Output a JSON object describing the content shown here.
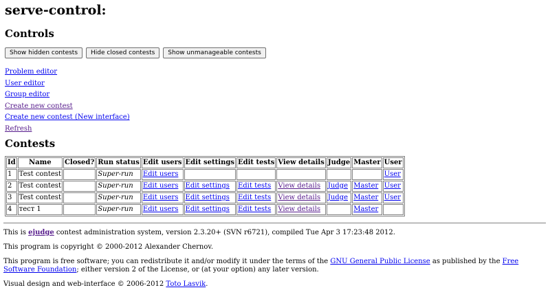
{
  "page_title": "serve-control:",
  "controls": {
    "heading": "Controls",
    "buttons": [
      "Show hidden contests",
      "Hide closed contests",
      "Show unmanageable contests"
    ],
    "links": [
      {
        "label": "Problem editor",
        "visited": false
      },
      {
        "label": "User editor",
        "visited": false
      },
      {
        "label": "Group editor",
        "visited": false
      },
      {
        "label": "Create new contest",
        "visited": true
      },
      {
        "label": "Create new contest (New interface)",
        "visited": false
      },
      {
        "label": "Refresh",
        "visited": true
      }
    ]
  },
  "contests": {
    "heading": "Contests",
    "columns": [
      "Id",
      "Name",
      "Closed?",
      "Run status",
      "Edit users",
      "Edit settings",
      "Edit tests",
      "View details",
      "Judge",
      "Master",
      "User"
    ],
    "rows": [
      {
        "id": "1",
        "name": "Test contest",
        "closed": "",
        "run_status": "Super-run",
        "edit_users": "Edit users",
        "edit_settings": "",
        "edit_tests": "",
        "view_details": "",
        "judge": "",
        "master": "",
        "user": "User"
      },
      {
        "id": "2",
        "name": "Test contest",
        "closed": "",
        "run_status": "Super-run",
        "edit_users": "Edit users",
        "edit_settings": "Edit settings",
        "edit_tests": "Edit tests",
        "view_details": "View details",
        "judge": "Judge",
        "master": "Master",
        "user": "User"
      },
      {
        "id": "3",
        "name": "Test contest",
        "closed": "",
        "run_status": "Super-run",
        "edit_users": "Edit users",
        "edit_settings": "Edit settings",
        "edit_tests": "Edit tests",
        "view_details": "View details",
        "judge": "Judge",
        "master": "Master",
        "user": "User"
      },
      {
        "id": "4",
        "name": "тест 1",
        "closed": "",
        "run_status": "Super-run",
        "edit_users": "Edit users",
        "edit_settings": "Edit settings",
        "edit_tests": "Edit tests",
        "view_details": "View details",
        "judge": "",
        "master": "Master",
        "user": ""
      }
    ]
  },
  "footer": {
    "line1_prefix": "This is ",
    "line1_link": "ejudge",
    "line1_suffix": " contest administration system, version 2.3.20+ (SVN r6721), compiled Tue Apr 3 17:23:48 2012.",
    "line2": "This program is copyright © 2000-2012 Alexander Chernov.",
    "line3_prefix": "This program is free software; you can redistribute it and/or modify it under the terms of the ",
    "line3_link1": "GNU General Public License",
    "line3_mid": " as published by the ",
    "line3_link2": "Free Software Foundation",
    "line3_suffix": "; either version 2 of the License, or (at your option) any later version.",
    "line4_prefix": "Visual design and web-interface © 2006-2012 ",
    "line4_link": "Toto Lasvik",
    "line4_suffix": "."
  },
  "colors": {
    "link": "#0000ee",
    "visited": "#551a8b",
    "border": "#808080"
  }
}
